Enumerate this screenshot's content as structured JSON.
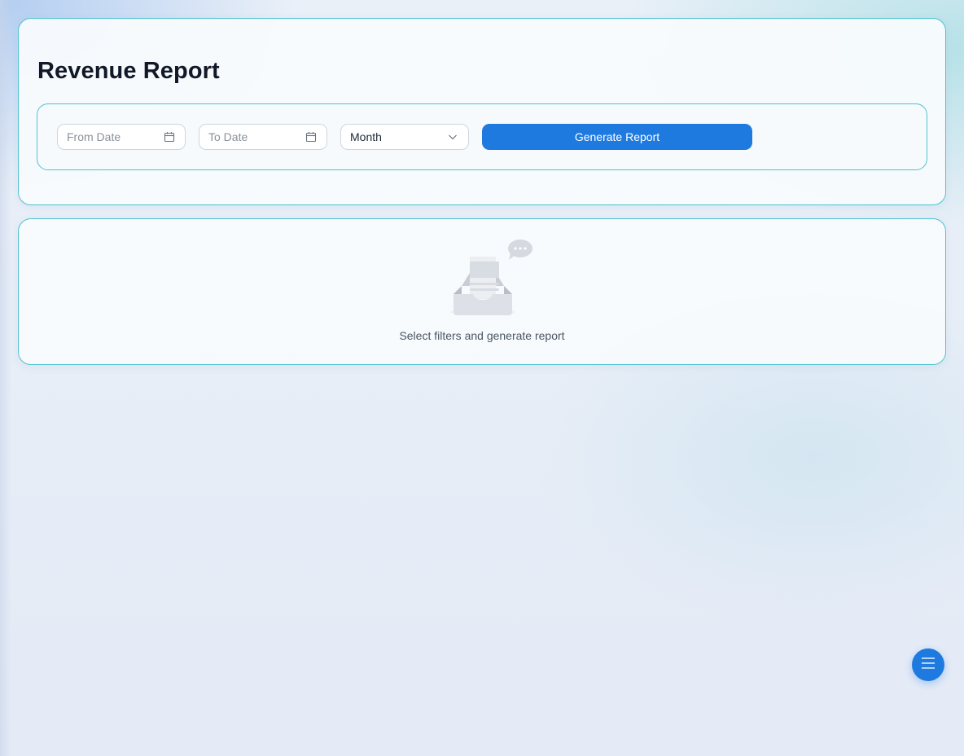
{
  "report": {
    "title": "Revenue Report"
  },
  "filters": {
    "from_date": {
      "value": "",
      "placeholder": "From Date",
      "icon": "calendar-icon"
    },
    "to_date": {
      "value": "",
      "placeholder": "To Date",
      "icon": "calendar-icon"
    },
    "granularity": {
      "selected": "Month",
      "icon": "chevron-down-icon"
    },
    "generate_label": "Generate Report"
  },
  "empty_state": {
    "message": "Select filters and generate report",
    "icon": "empty-inbox-icon"
  },
  "fab": {
    "icon": "menu-icon"
  },
  "colors": {
    "accent": "#1f7ae0",
    "card_border": "#4fc3cf",
    "title": "#111827"
  }
}
